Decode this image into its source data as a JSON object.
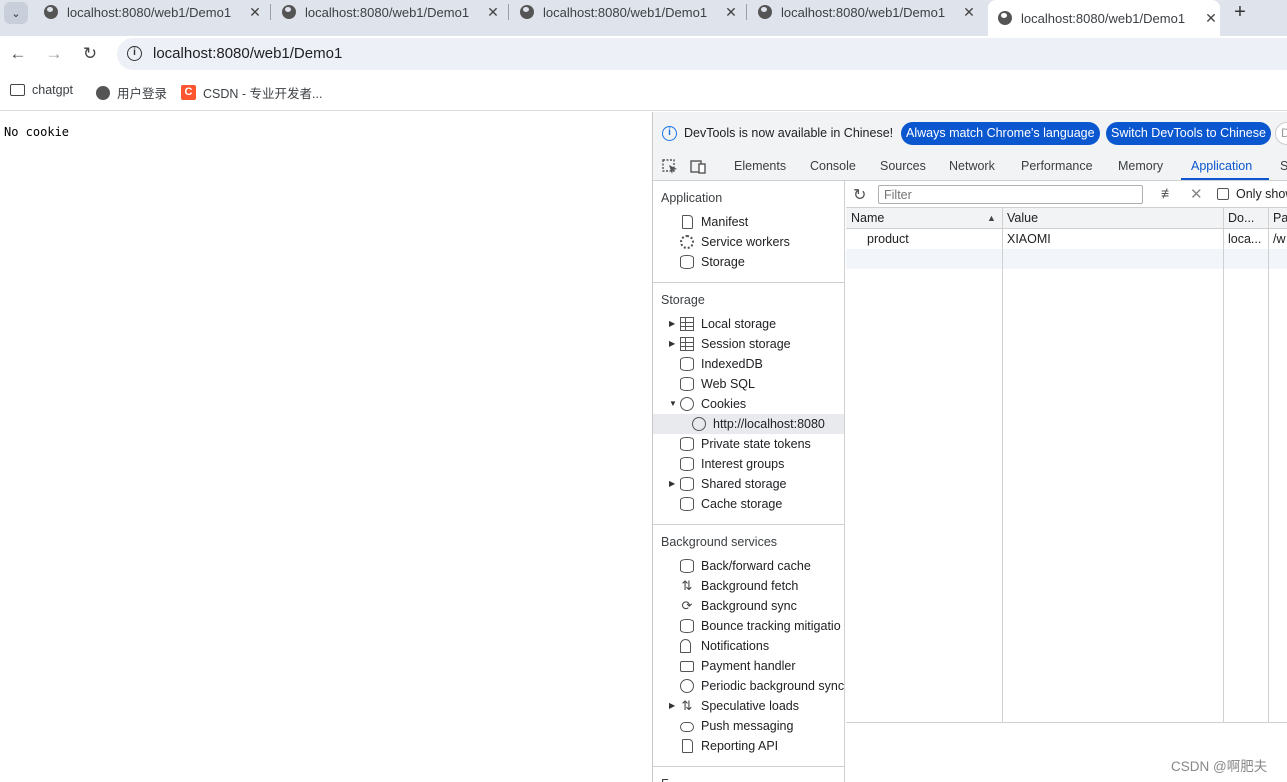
{
  "tabs": [
    {
      "title": "localhost:8080/web1/Demo1",
      "close": "✕"
    },
    {
      "title": "localhost:8080/web1/Demo1",
      "close": "✕"
    },
    {
      "title": "localhost:8080/web1/Demo1",
      "close": "✕"
    },
    {
      "title": "localhost:8080/web1/Demo1",
      "close": "✕"
    },
    {
      "title": "localhost:8080/web1/Demo1",
      "close": "✕",
      "active": true
    }
  ],
  "new_tab": "+",
  "address": {
    "url": "localhost:8080/web1/Demo1"
  },
  "bookmarks": [
    {
      "label": "chatgpt",
      "icon": "folder-icon"
    },
    {
      "label": "用户登录",
      "icon": "globe-icon"
    },
    {
      "label": "CSDN - 专业开发者...",
      "icon": "csdn-icon"
    }
  ],
  "page": {
    "text": "No cookie"
  },
  "devtools": {
    "infobar": {
      "message": "DevTools is now available in Chinese!",
      "btn_match": "Always match Chrome's language",
      "btn_switch": "Switch DevTools to Chinese",
      "btn_d": "D"
    },
    "tabs": [
      "Elements",
      "Console",
      "Sources",
      "Network",
      "Performance",
      "Memory",
      "Application",
      "S"
    ],
    "active_tab": "Application",
    "sidebar": {
      "application_header": "Application",
      "application_items": [
        "Manifest",
        "Service workers",
        "Storage"
      ],
      "storage_header": "Storage",
      "storage_items": [
        "Local storage",
        "Session storage",
        "IndexedDB",
        "Web SQL",
        "Cookies",
        "http://localhost:8080",
        "Private state tokens",
        "Interest groups",
        "Shared storage",
        "Cache storage"
      ],
      "background_header": "Background services",
      "background_items": [
        "Back/forward cache",
        "Background fetch",
        "Background sync",
        "Bounce tracking mitigatio",
        "Notifications",
        "Payment handler",
        "Periodic background sync",
        "Speculative loads",
        "Push messaging",
        "Reporting API"
      ],
      "frames_header": "F"
    },
    "toolbar": {
      "filter_placeholder": "Filter",
      "only_show": "Only show"
    },
    "table": {
      "columns": [
        "Name",
        "Value",
        "Do...",
        "Pa"
      ],
      "rows": [
        {
          "name": "product",
          "value": "XIAOMI",
          "domain": "loca...",
          "path": "/w"
        }
      ]
    }
  },
  "watermark": "CSDN @啊肥夫"
}
